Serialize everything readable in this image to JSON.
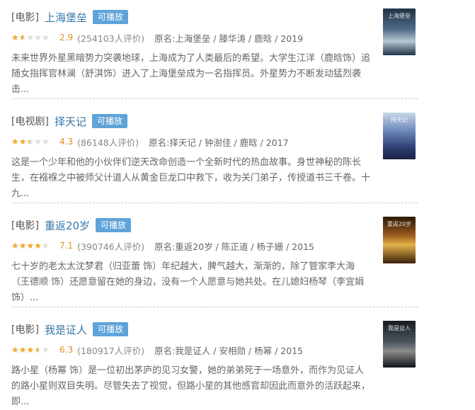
{
  "items": [
    {
      "category": "[电影]",
      "title": "上海堡垒",
      "badge": "可播放",
      "rating_fraction": 0.29,
      "score": "2.9",
      "votes": "(254103人评价)",
      "meta": "原名:上海堡垒 / 滕华涛 / 鹿晗 / 2019",
      "desc": "未来世界外星黑暗势力突袭地球，上海成为了人类最后的希望。大学生江洋（鹿晗饰）追随女指挥官林澜（舒淇饰）进入了上海堡垒成为一名指挥员。外星势力不断发动猛烈袭击..."
    },
    {
      "category": "[电视剧]",
      "title": "择天记",
      "badge": "可播放",
      "rating_fraction": 0.43,
      "score": "4.3",
      "votes": "(86148人评价)",
      "meta": "原名:择天记 / 钟澍佳 / 鹿晗 / 2017",
      "desc": "这是一个少年和他的小伙伴们逆天改命创造一个全新时代的热血故事。身世神秘的陈长生，在襁褓之中被师父计道人从黄金巨龙口中救下，收为关门弟子，传授道书三千卷。十九..."
    },
    {
      "category": "[电影]",
      "title": "重返20岁",
      "badge": "可播放",
      "rating_fraction": 0.71,
      "score": "7.1",
      "votes": "(390746人评价)",
      "meta": "原名:重返20岁 / 陈正道 / 杨子姗 / 2015",
      "desc": "七十岁的老太太沈梦君（归亚蕾 饰）年纪越大，脾气越大，渐渐的，除了管家李大海（王德顺 饰）还愿意留在她的身边，没有一个人愿意与她共处。在儿媳妇杨琴（李宜娟 饰）..."
    },
    {
      "category": "[电影]",
      "title": "我是证人",
      "badge": "可播放",
      "rating_fraction": 0.63,
      "score": "6.3",
      "votes": "(180917人评价)",
      "meta": "原名:我是证人 / 安相勋 / 杨幂 / 2015",
      "desc": "路小星（杨幂 饰）是一位初出茅庐的见习女警，她的弟弟死于一场意外，而作为见证人的路小星则双目失明。尽管失去了视觉，但路小星的其他感官却因此而意外的活跃起来，即..."
    }
  ],
  "icons": {
    "star": "star-icon"
  },
  "colors": {
    "title": "#3377aa",
    "badge": "#5fa3d8",
    "star": "#f5a623",
    "score": "#e09015"
  }
}
